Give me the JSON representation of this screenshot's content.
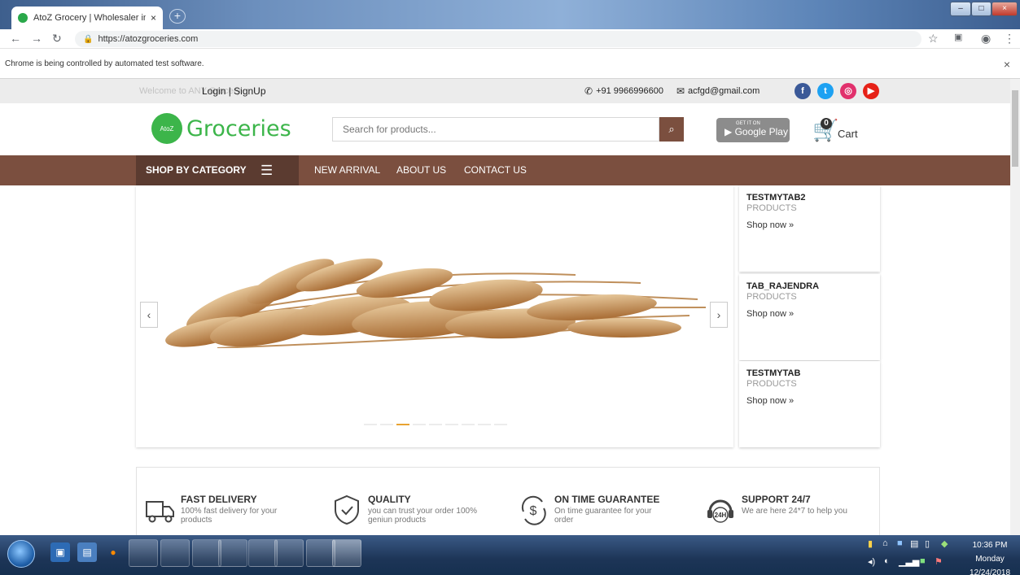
{
  "browser": {
    "tab_title": "AtoZ Grocery | Wholesaler in Ban",
    "tab_close": "×",
    "new_tab": "+",
    "url": "https://atozgroceries.com",
    "infobar_text": "Chrome is being controlled by automated test software.",
    "infobar_close": "×"
  },
  "topbar": {
    "welcome": "Welcome to ANY Grocery",
    "login_signup": "Login | SignUp",
    "phone": "+91 9966996600",
    "email": "acfgd@gmail.com"
  },
  "header": {
    "logo_badge": "AtoZ",
    "logo_text": "Groceries",
    "search_placeholder": "Search for products...",
    "gplay_small": "GET IT ON",
    "gplay_label": "Google Play",
    "cart_count": "0",
    "cart_label": "Cart"
  },
  "menu": {
    "shop_by_category": "SHOP BY CATEGORY",
    "links": [
      "NEW ARRIVAL",
      "ABOUT US",
      "CONTACT US"
    ]
  },
  "slider": {
    "active_dot": 2,
    "dot_count": 9,
    "prev": "‹",
    "next": "›"
  },
  "promos": [
    {
      "title": "TESTMYTAB2",
      "subtitle": "PRODUCTS",
      "link": "Shop now »"
    },
    {
      "title": "TAB_RAJENDRA",
      "subtitle": "PRODUCTS",
      "link": "Shop now »"
    },
    {
      "title": "TESTMYTAB",
      "subtitle": "PRODUCTS",
      "link": "Shop now »"
    }
  ],
  "features": [
    {
      "title": "FAST DELIVERY",
      "text": "100% fast delivery for your products",
      "icon": "truck-icon"
    },
    {
      "title": "QUALITY",
      "text": "you can trust your order 100% geniun products",
      "icon": "shield-check-icon"
    },
    {
      "title": "ON TIME GUARANTEE",
      "text": "On time guarantee for your order",
      "icon": "dollar-cycle-icon"
    },
    {
      "title": "SUPPORT 24/7",
      "text": "We are here 24*7 to help you",
      "icon": "headset-icon",
      "badge": "24H"
    }
  ],
  "colors": {
    "brand_brown": "#7b4f3f",
    "brand_dark_brown": "#5b3b30",
    "brand_green": "#3cb54a",
    "accent_orange": "#e8a331"
  },
  "taskbar": {
    "time": "10:36 PM",
    "day": "Monday",
    "date": "12/24/2018"
  }
}
